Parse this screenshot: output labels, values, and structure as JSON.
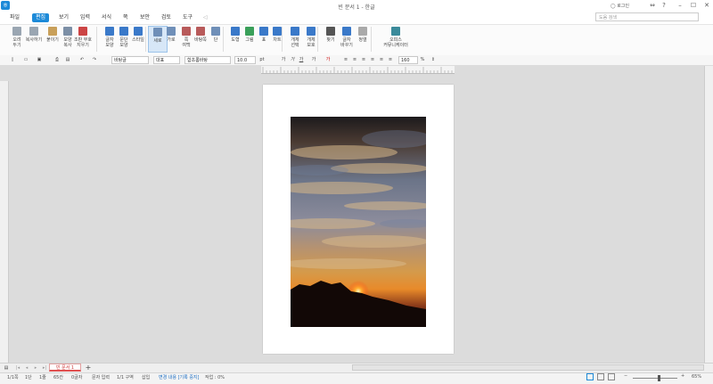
{
  "window": {
    "title": "빈 문서 1 - 한글",
    "login_label": "로그인",
    "help_label": "?",
    "minimize": "–",
    "maximize": "☐",
    "close": "✕"
  },
  "menu": {
    "file": "파일",
    "items": [
      "편집",
      "보기",
      "입력",
      "서식",
      "쪽",
      "보안",
      "검토",
      "도구"
    ],
    "search_placeholder": "도움 검색"
  },
  "ribbon": {
    "buttons": [
      {
        "label": "오려\n두기",
        "color": "#9aa6b2"
      },
      {
        "label": "복사하기",
        "color": "#9aa6b2"
      },
      {
        "label": "붙이기",
        "color": "#c9a05a"
      },
      {
        "label": "모양\n복사",
        "color": "#7c8fa6"
      },
      {
        "label": "조판 부호\n지우기",
        "color": "#c44"
      },
      {
        "label": "글자\n모양",
        "color": "#3a79c9"
      },
      {
        "label": "문단\n모양",
        "color": "#3a79c9"
      },
      {
        "label": "스타일",
        "color": "#3a79c9"
      },
      {
        "label": "세로",
        "color": "#6f8fb8",
        "selected": true
      },
      {
        "label": "가로",
        "color": "#6f8fb8"
      },
      {
        "label": "쪽\n여백",
        "color": "#b85a5a"
      },
      {
        "label": "바탕쪽",
        "color": "#b85a5a"
      },
      {
        "label": "단",
        "color": "#6f8fb8"
      },
      {
        "label": "도형",
        "color": "#3a79c9"
      },
      {
        "label": "그림",
        "color": "#3aa05a"
      },
      {
        "label": "표",
        "color": "#3a79c9"
      },
      {
        "label": "차트",
        "color": "#3a79c9"
      },
      {
        "label": "개체\n선택",
        "color": "#3a79c9"
      },
      {
        "label": "개체\n보호",
        "color": "#3a79c9"
      },
      {
        "label": "찾기",
        "color": "#555"
      },
      {
        "label": "글자\n바꾸기",
        "color": "#3a79c9"
      },
      {
        "label": "정렬",
        "color": "#aaa"
      },
      {
        "label": "오피스\n커뮤니케이터",
        "color": "#3a8a9a"
      }
    ]
  },
  "format": {
    "style": "바탕글",
    "lang": "대표",
    "font": "함초롬바탕",
    "size": "10.0",
    "unit": "pt",
    "zoom": "160",
    "zoom_unit": "%"
  },
  "tabs": {
    "doc_tab": "빈 문서 1",
    "add": "+"
  },
  "status": {
    "page": "1/1쪽",
    "section": "1단",
    "line": "1줄",
    "col": "65칸",
    "chars": "0글자",
    "input_mode": "문자 입력",
    "dist": "1/1 구역",
    "insert": "삽입",
    "track": "변경 내용 [기록 중지]",
    "tasks": "작업 : 0%",
    "zoom": "65%"
  }
}
